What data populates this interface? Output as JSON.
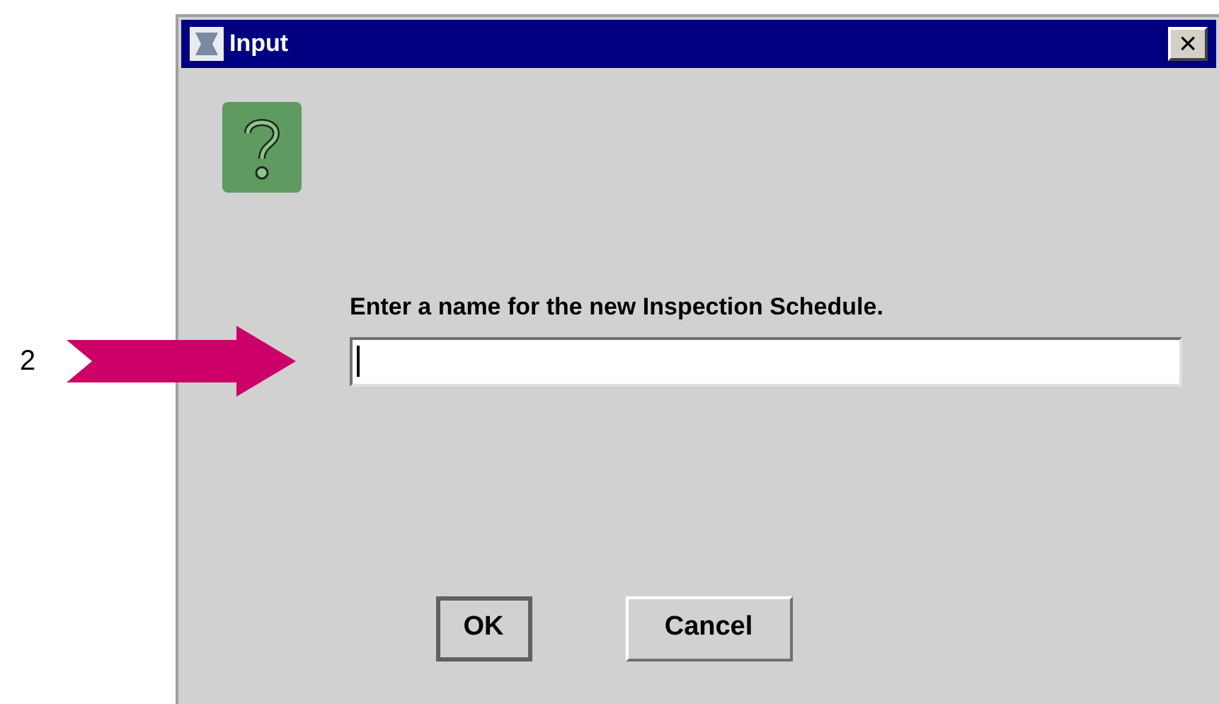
{
  "callout": {
    "label": "2"
  },
  "window": {
    "title": "Input",
    "close_label": "×"
  },
  "dialog": {
    "prompt": "Enter a name for the new Inspection Schedule.",
    "input": {
      "focused": true
    }
  },
  "buttons": [
    {
      "label": "OK",
      "default": true
    },
    {
      "label": "Cancel",
      "default": false
    }
  ]
}
